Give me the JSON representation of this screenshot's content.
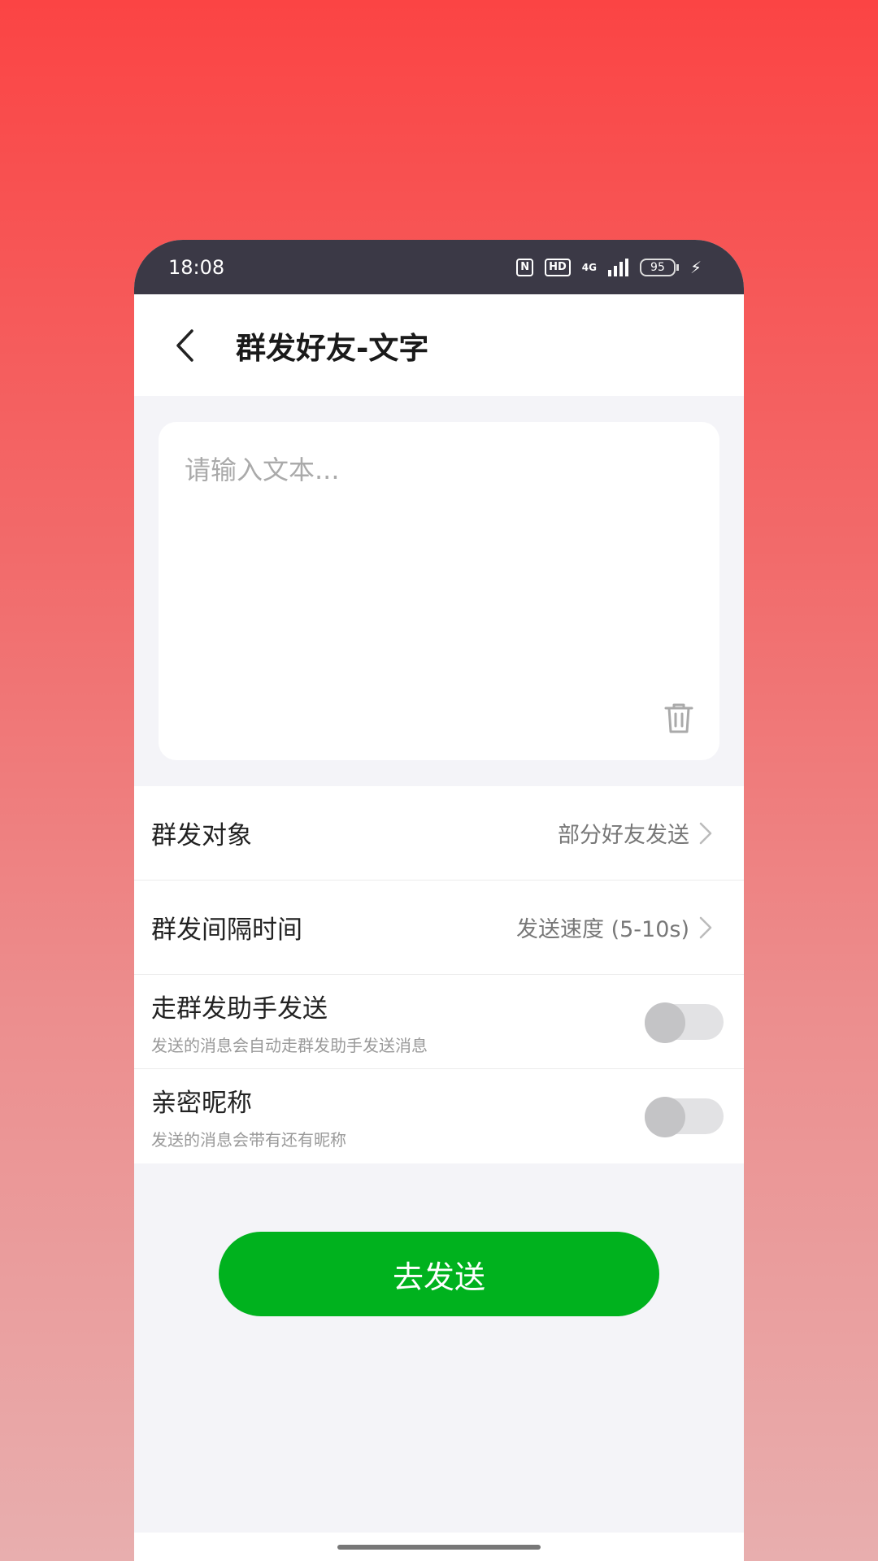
{
  "status_bar": {
    "time": "18:08",
    "nfc": "N",
    "hd": "HD",
    "network": "4G",
    "battery": "95"
  },
  "header": {
    "title": "群发好友-文字"
  },
  "editor": {
    "placeholder": "请输入文本...",
    "value": ""
  },
  "settings": {
    "target": {
      "label": "群发对象",
      "value": "部分好友发送"
    },
    "interval": {
      "label": "群发间隔时间",
      "value": "发送速度 (5-10s)"
    },
    "assistant": {
      "label": "走群发助手发送",
      "sub": "发送的消息会自动走群发助手发送消息",
      "enabled": false
    },
    "nickname": {
      "label": "亲密昵称",
      "sub": "发送的消息会带有还有昵称",
      "enabled": false
    }
  },
  "send_button": {
    "label": "去发送",
    "color": "#00b21e"
  },
  "colors": {
    "status_bar_bg": "#3b3946",
    "page_bg": "#f4f4f8",
    "accent": "#00b21e"
  }
}
